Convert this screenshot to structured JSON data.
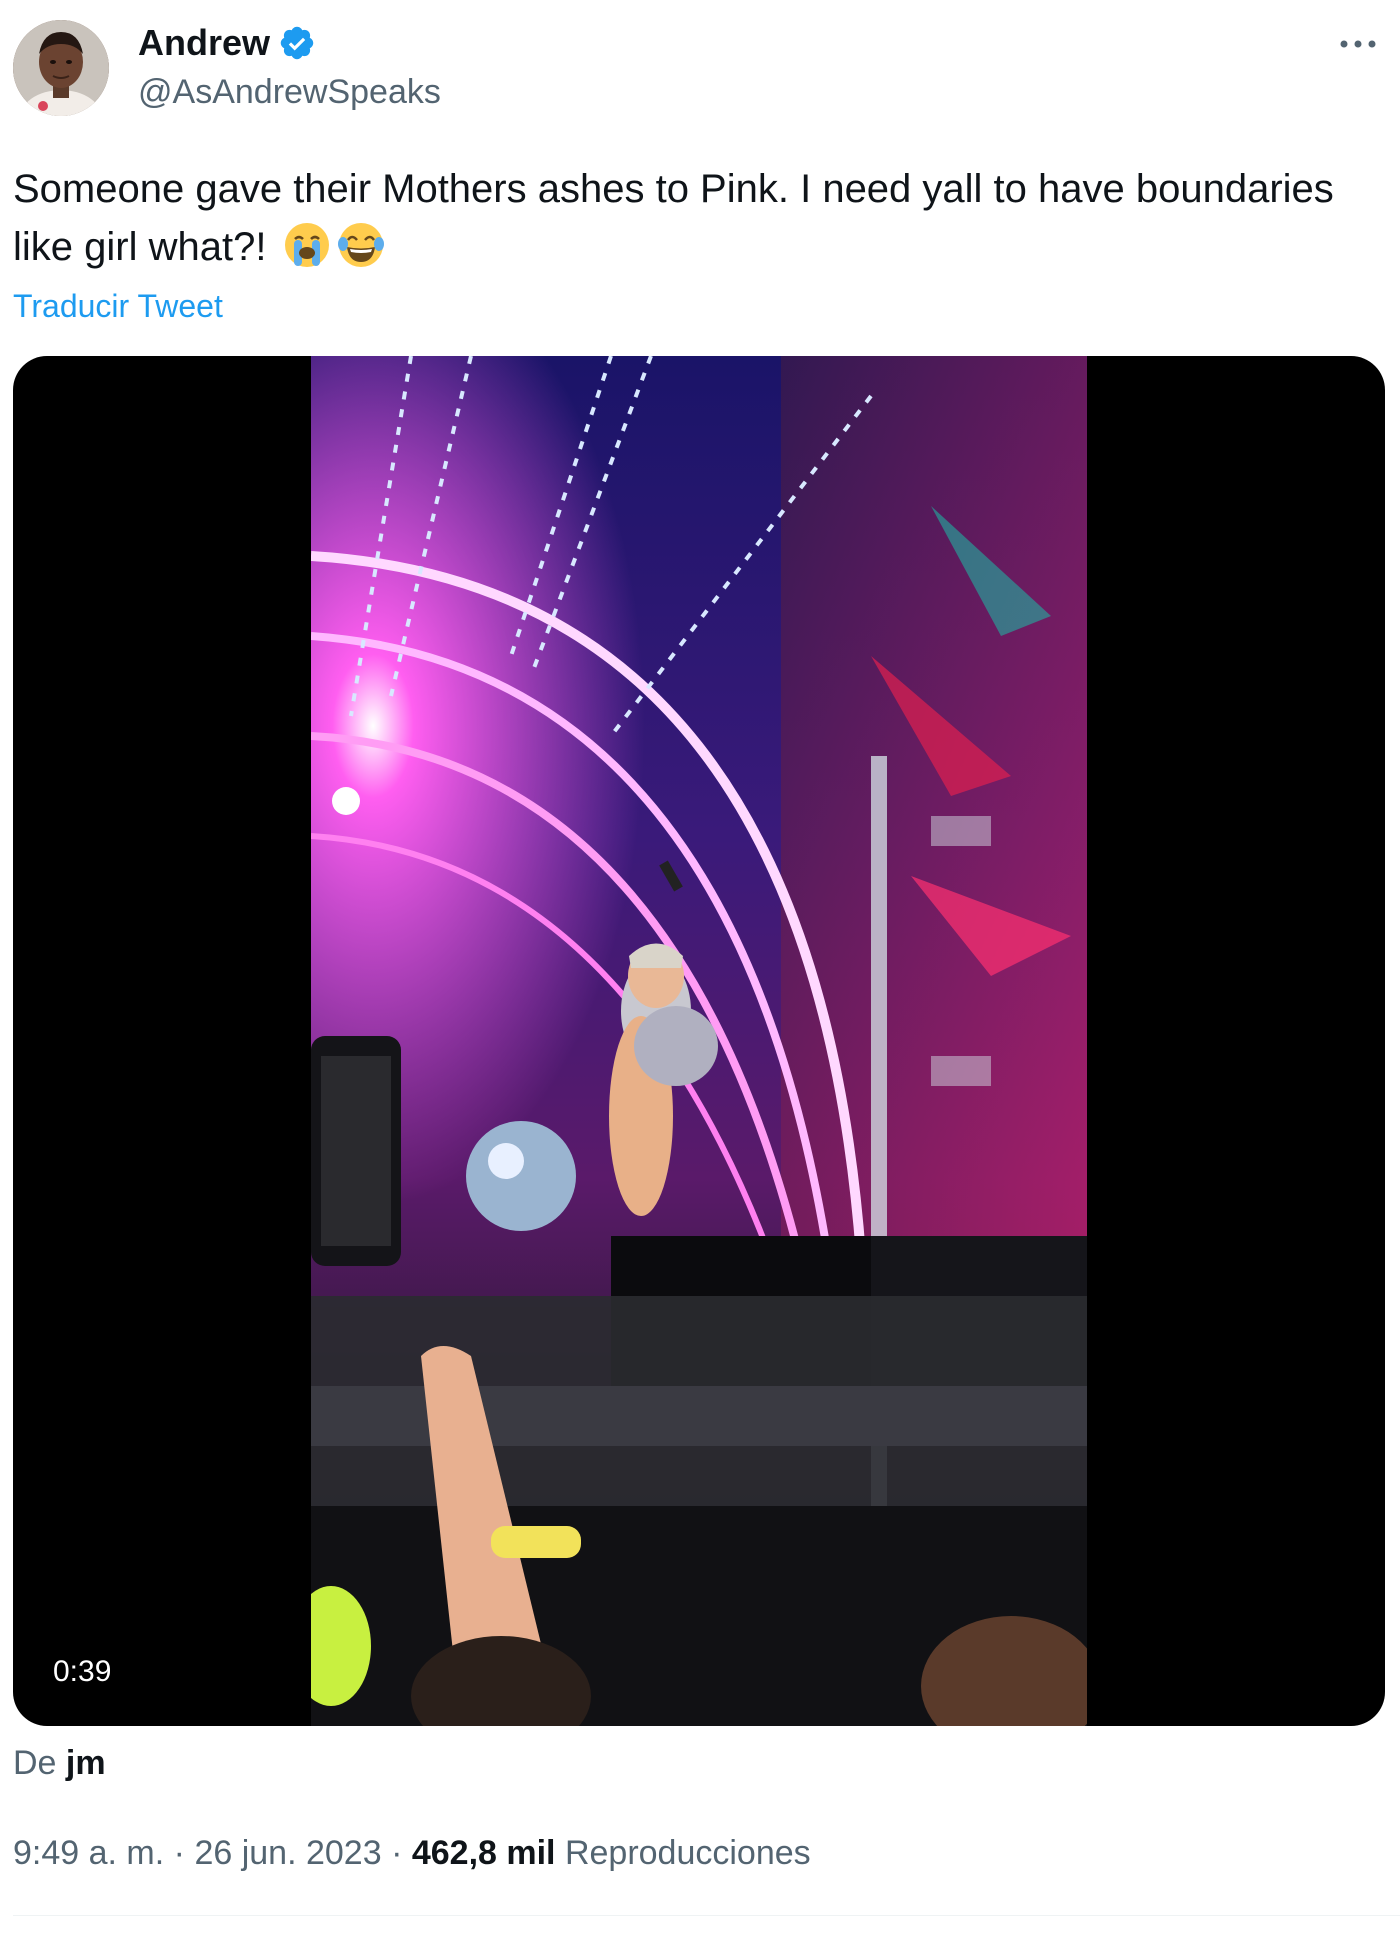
{
  "author": {
    "display_name": "Andrew",
    "handle": "@AsAndrewSpeaks",
    "verified": true,
    "verified_color": "#1d9bf0"
  },
  "tweet": {
    "text": "Someone gave their Mothers ashes to Pink. I need yall to have boundaries like girl what?!",
    "emojis": [
      "loudly-crying-face",
      "face-with-tears-of-joy"
    ],
    "translate_label": "Traducir Tweet"
  },
  "media": {
    "type": "video",
    "duration": "0:39"
  },
  "source": {
    "prefix": "De",
    "name": "jm"
  },
  "meta": {
    "time": "9:49 a. m.",
    "separator": "·",
    "date": "26 jun. 2023",
    "views_count": "462,8 mil",
    "views_label": "Reproducciones"
  },
  "colors": {
    "text_primary": "#0f1419",
    "text_secondary": "#536471",
    "link": "#1d9bf0"
  },
  "icons": {
    "verified": "verified-badge-icon",
    "more": "more-options-icon"
  }
}
